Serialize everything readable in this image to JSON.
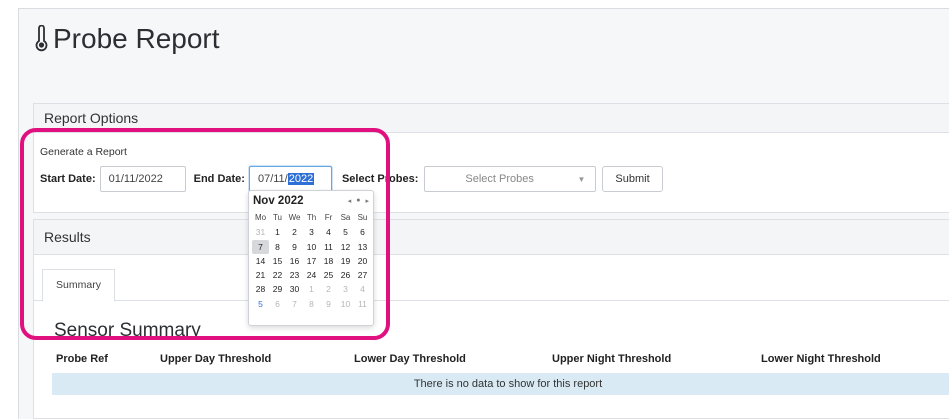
{
  "page": {
    "title": "Probe Report",
    "title_icon": "thermometer-icon"
  },
  "options": {
    "header": "Report Options",
    "generate_label": "Generate a Report",
    "start_label": "Start Date:",
    "start_value": "01/11/2022",
    "end_label": "End Date:",
    "end_value_prefix": "07/11/",
    "end_value_selected": "2022",
    "probes_label": "Select Probes:",
    "probes_placeholder": "Select Probes",
    "submit_label": "Submit"
  },
  "calendar": {
    "title": "Nov 2022",
    "nav": [
      "◂",
      "●",
      "▸"
    ],
    "weekdays": [
      "Mo",
      "Tu",
      "We",
      "Th",
      "Fr",
      "Sa",
      "Su"
    ],
    "days": [
      {
        "d": "31",
        "m": true
      },
      {
        "d": "1"
      },
      {
        "d": "2"
      },
      {
        "d": "3"
      },
      {
        "d": "4"
      },
      {
        "d": "5"
      },
      {
        "d": "6"
      },
      {
        "d": "7",
        "today": true
      },
      {
        "d": "8"
      },
      {
        "d": "9"
      },
      {
        "d": "10"
      },
      {
        "d": "11"
      },
      {
        "d": "12"
      },
      {
        "d": "13"
      },
      {
        "d": "14"
      },
      {
        "d": "15"
      },
      {
        "d": "16"
      },
      {
        "d": "17"
      },
      {
        "d": "18"
      },
      {
        "d": "19"
      },
      {
        "d": "20"
      },
      {
        "d": "21"
      },
      {
        "d": "22"
      },
      {
        "d": "23"
      },
      {
        "d": "24"
      },
      {
        "d": "25"
      },
      {
        "d": "26"
      },
      {
        "d": "27"
      },
      {
        "d": "28"
      },
      {
        "d": "29"
      },
      {
        "d": "30"
      },
      {
        "d": "1",
        "m": true
      },
      {
        "d": "2",
        "m": true
      },
      {
        "d": "3",
        "m": true
      },
      {
        "d": "4",
        "m": true
      },
      {
        "d": "5",
        "m": true,
        "sel": true
      },
      {
        "d": "6",
        "m": true
      },
      {
        "d": "7",
        "m": true
      },
      {
        "d": "8",
        "m": true
      },
      {
        "d": "9",
        "m": true
      },
      {
        "d": "10",
        "m": true
      },
      {
        "d": "11",
        "m": true
      }
    ]
  },
  "results": {
    "header": "Results",
    "tab": "Summary",
    "sensor_title": "Sensor Summary",
    "columns": [
      "Probe Ref",
      "Upper Day Threshold",
      "Lower Day Threshold",
      "Upper Night Threshold",
      "Lower Night Threshold"
    ],
    "empty": "There is no data to show for this report"
  },
  "colors": {
    "highlight": "#e0117f",
    "selection": "#2d6fd6",
    "nodata_bg": "#d9eaf4"
  }
}
